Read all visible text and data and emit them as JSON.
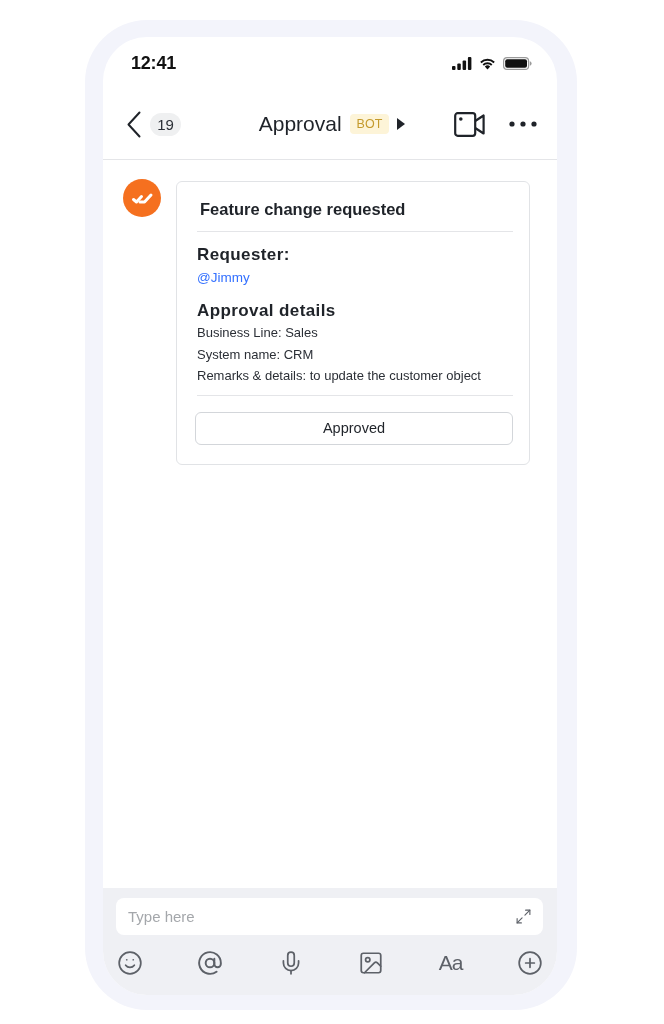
{
  "status_bar": {
    "time": "12:41"
  },
  "nav_bar": {
    "unread_count": "19",
    "title": "Approval",
    "tag": "BOT"
  },
  "messages": [
    {
      "card": {
        "title": "Feature change requested",
        "sections": [
          {
            "heading": "Requester:",
            "kind": "mention",
            "lines": [
              "@Jimmy"
            ]
          },
          {
            "heading": "Approval details",
            "kind": "text",
            "lines": [
              "Business Line: Sales",
              "System name: CRM",
              "Remarks & details: to update the customer object"
            ]
          }
        ],
        "button": "Approved"
      }
    }
  ],
  "composer": {
    "placeholder": "Type here",
    "format_label": "Aa"
  }
}
